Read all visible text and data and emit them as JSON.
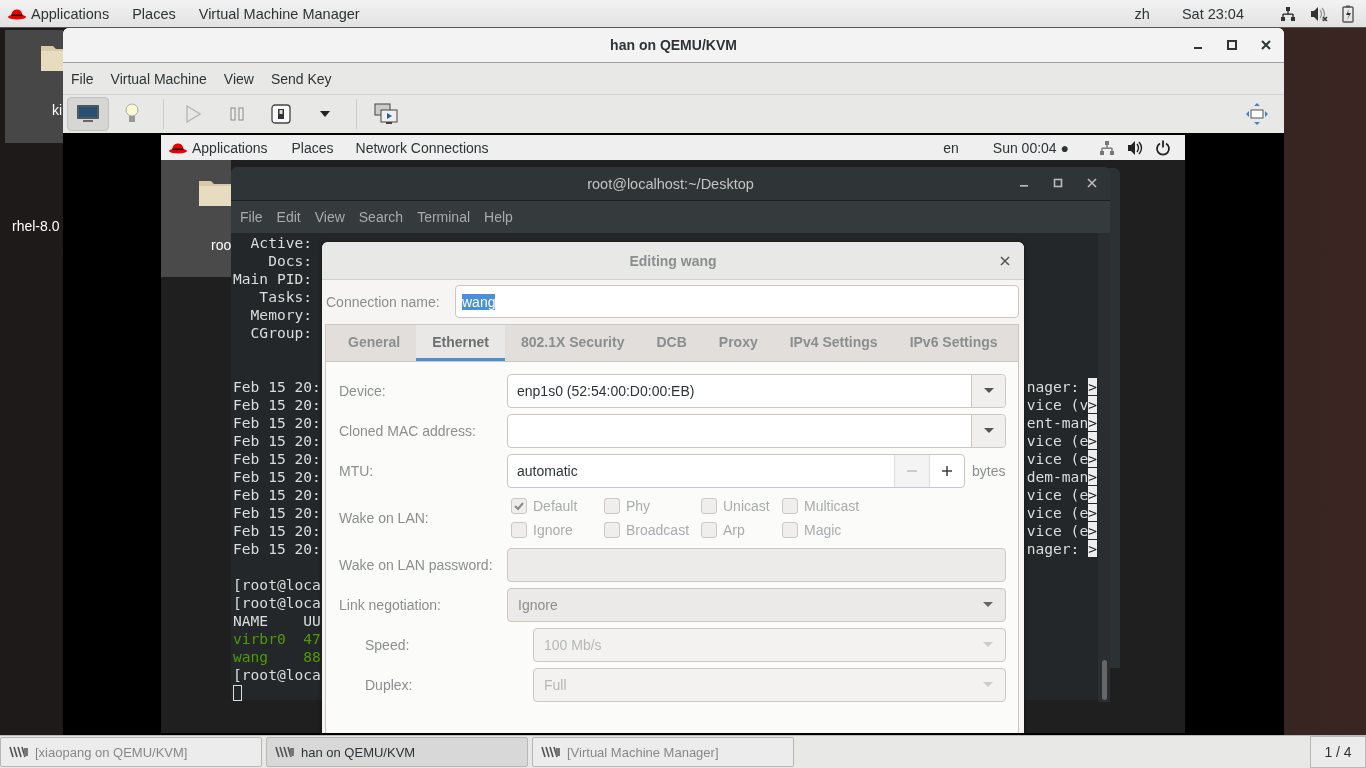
{
  "host_top_bar": {
    "menus": [
      "Applications",
      "Places",
      "Virtual Machine Manager"
    ],
    "input_method": "zh",
    "clock": "Sat 23:04"
  },
  "host_desktop_icons": [
    {
      "label": "ki",
      "selected": true
    },
    {
      "label": "rhel-8.0",
      "selected": false
    }
  ],
  "vm_window": {
    "title": "han on QEMU/KVM",
    "menu": [
      "File",
      "Virtual Machine",
      "View",
      "Send Key"
    ],
    "toolbar": [
      {
        "kind": "console",
        "pressed": true
      },
      {
        "kind": "details",
        "pressed": false
      },
      {
        "kind": "separator"
      },
      {
        "kind": "run",
        "disabled": true
      },
      {
        "kind": "pause",
        "disabled": false
      },
      {
        "kind": "shutdown",
        "disabled": false
      },
      {
        "kind": "dropdown"
      },
      {
        "kind": "separator"
      },
      {
        "kind": "snapshots"
      },
      {
        "kind": "fullscreen"
      }
    ]
  },
  "guest": {
    "top_bar": {
      "menus": [
        "Applications",
        "Places",
        "Network Connections"
      ],
      "input_method": "en",
      "clock": "Sun 00:04 ●"
    },
    "desktop_icons": [
      {
        "label": "roo",
        "selected": true
      }
    ],
    "terminal": {
      "title": "root@localhost:~/Desktop",
      "menu": [
        "File",
        "Edit",
        "View",
        "Search",
        "Terminal",
        "Help"
      ],
      "lines": [
        {
          "kind": "text",
          "segments": [
            {
              "text": "  Active:"
            }
          ]
        },
        {
          "kind": "text",
          "segments": [
            {
              "text": "    Docs:"
            }
          ]
        },
        {
          "kind": "text",
          "segments": [
            {
              "text": "Main PID:"
            }
          ]
        },
        {
          "kind": "text",
          "segments": [
            {
              "text": "   Tasks:"
            }
          ]
        },
        {
          "kind": "text",
          "segments": [
            {
              "text": "  Memory:"
            }
          ]
        },
        {
          "kind": "text",
          "segments": [
            {
              "text": "  CGroup:"
            }
          ]
        },
        {
          "kind": "blank"
        },
        {
          "kind": "blank"
        },
        {
          "kind": "text",
          "segments": [
            {
              "text": "Feb 15 20:"
            }
          ],
          "tail": {
            "text": "nager: ",
            "marker": ">"
          }
        },
        {
          "kind": "text",
          "segments": [
            {
              "text": "Feb 15 20:"
            }
          ],
          "tail": {
            "text": "vice (v",
            "marker": ">"
          }
        },
        {
          "kind": "text",
          "segments": [
            {
              "text": "Feb 15 20:"
            }
          ],
          "tail": {
            "text": "ent-man",
            "marker": ">"
          }
        },
        {
          "kind": "text",
          "segments": [
            {
              "text": "Feb 15 20:"
            }
          ],
          "tail": {
            "text": "vice (e",
            "marker": ">"
          }
        },
        {
          "kind": "text",
          "segments": [
            {
              "text": "Feb 15 20:"
            }
          ],
          "tail": {
            "text": "vice (e",
            "marker": ">"
          }
        },
        {
          "kind": "text",
          "segments": [
            {
              "text": "Feb 15 20:"
            }
          ],
          "tail": {
            "text": "dem-man",
            "marker": ">"
          }
        },
        {
          "kind": "text",
          "segments": [
            {
              "text": "Feb 15 20:"
            }
          ],
          "tail": {
            "text": "vice (e",
            "marker": ">"
          }
        },
        {
          "kind": "text",
          "segments": [
            {
              "text": "Feb 15 20:"
            }
          ],
          "tail": {
            "text": "vice (e",
            "marker": ">"
          }
        },
        {
          "kind": "text",
          "segments": [
            {
              "text": "Feb 15 20:"
            }
          ],
          "tail": {
            "text": "vice (e",
            "marker": ">"
          }
        },
        {
          "kind": "text",
          "segments": [
            {
              "text": "Feb 15 20:"
            }
          ],
          "tail": {
            "text": "nager: ",
            "marker": ">"
          }
        },
        {
          "kind": "blank"
        },
        {
          "kind": "text",
          "segments": [
            {
              "text": "[root@loca"
            }
          ]
        },
        {
          "kind": "text",
          "segments": [
            {
              "text": "[root@loca"
            }
          ]
        },
        {
          "kind": "text",
          "segments": [
            {
              "text": "NAME    UU"
            }
          ]
        },
        {
          "kind": "text",
          "segments": [
            {
              "text": "virbr0  47",
              "color": "#4e9a06"
            }
          ]
        },
        {
          "kind": "text",
          "segments": [
            {
              "text": "wang    88",
              "color": "#4e9a06"
            }
          ]
        },
        {
          "kind": "text",
          "segments": [
            {
              "text": "[root@loca"
            }
          ]
        },
        {
          "kind": "cursor"
        }
      ]
    },
    "dialog": {
      "title": "Editing wang",
      "connection_name": {
        "label": "Connection name:",
        "value": "wang",
        "text_selected": true
      },
      "tabs": [
        {
          "label": "General",
          "selected": false
        },
        {
          "label": "Ethernet",
          "selected": true
        },
        {
          "label": "802.1X Security",
          "selected": false
        },
        {
          "label": "DCB",
          "selected": false
        },
        {
          "label": "Proxy",
          "selected": false
        },
        {
          "label": "IPv4 Settings",
          "selected": false
        },
        {
          "label": "IPv6 Settings",
          "selected": false
        }
      ],
      "fields": [
        {
          "kind": "combo_entry",
          "label": "Device:",
          "value": "enp1s0 (52:54:00:D0:00:EB)"
        },
        {
          "kind": "combo_entry",
          "label": "Cloned MAC address:"
        },
        {
          "kind": "spin",
          "label": "MTU:",
          "value": "automatic",
          "unit": "bytes"
        },
        {
          "kind": "checks",
          "label": "Wake on LAN:",
          "options": [
            {
              "label": "Default",
              "checked": true,
              "disabled": true
            },
            {
              "label": "Phy",
              "checked": false,
              "disabled": true
            },
            {
              "label": "Unicast",
              "checked": false,
              "disabled": true
            },
            {
              "label": "Multicast",
              "checked": false,
              "disabled": true
            },
            {
              "label": "Ignore",
              "checked": false,
              "disabled": true
            },
            {
              "label": "Broadcast",
              "checked": false,
              "disabled": true
            },
            {
              "label": "Arp",
              "checked": false,
              "disabled": true
            },
            {
              "label": "Magic",
              "checked": false,
              "disabled": true
            }
          ]
        },
        {
          "kind": "entry",
          "label": "Wake on LAN password:",
          "disabled": true
        },
        {
          "kind": "combo",
          "label": "Link negotiation:",
          "value": "Ignore",
          "disabled": false,
          "children": [
            {
              "kind": "combo",
              "label": "Speed:",
              "value": "100 Mb/s",
              "disabled": true
            },
            {
              "kind": "combo",
              "label": "Duplex:",
              "value": "Full",
              "disabled": true
            }
          ]
        }
      ]
    }
  },
  "taskbar": {
    "tasks": [
      {
        "label": "[xiaopang on QEMU/KVM]",
        "selected": false
      },
      {
        "label": "han on QEMU/KVM",
        "selected": true
      },
      {
        "label": "[Virtual Machine Manager]",
        "selected": false
      }
    ],
    "workspace": "1 / 4"
  }
}
